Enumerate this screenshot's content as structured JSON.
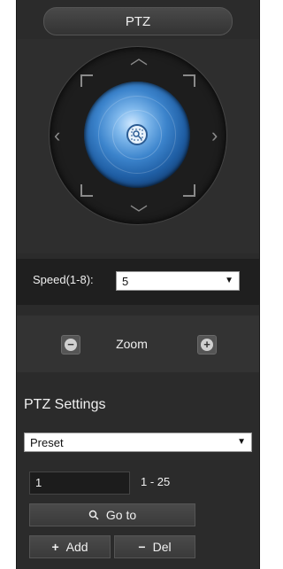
{
  "panel": {
    "title": "PTZ"
  },
  "ptz": {
    "directions": {
      "up": "up-arrow",
      "down": "down-arrow",
      "left": "left-arrow",
      "right": "right-arrow"
    },
    "center_icon": "auto-focus-icon",
    "dome_color": "#3c84cc"
  },
  "speed": {
    "label": "Speed(1-8):",
    "value": "5"
  },
  "zoom": {
    "minus_glyph": "−",
    "label": "Zoom",
    "plus_glyph": "+"
  },
  "settings": {
    "title": "PTZ Settings",
    "mode_value": "Preset",
    "number_value": "1",
    "range": "1 - 25",
    "goto_label": "Go to",
    "add_label": "Add",
    "del_label": "Del"
  }
}
